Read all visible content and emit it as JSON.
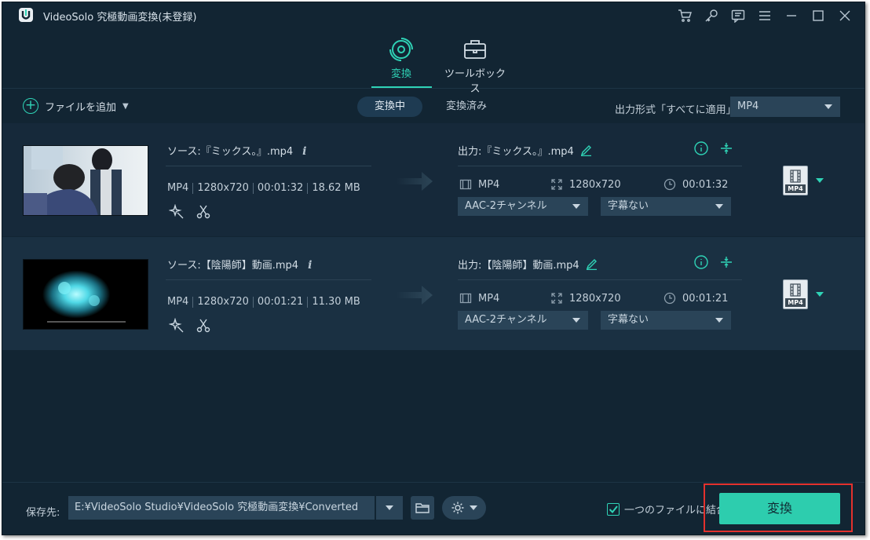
{
  "window": {
    "title": "VideoSolo 究極動画変換(未登録)"
  },
  "tabs": [
    {
      "label": "変換",
      "icon": "convert-disc-icon",
      "active": true
    },
    {
      "label": "ツールボックス",
      "icon": "toolbox-icon",
      "active": false
    }
  ],
  "toolbar": {
    "add_file_label": "ファイルを追加",
    "segments": [
      "変換中",
      "変換済み"
    ],
    "output_format_label": "出力形式「すべてに適用」:",
    "output_format_value": "MP4"
  },
  "files": [
    {
      "source_name": "ソース:『ミックス。』.mp4",
      "format": "MP4",
      "resolution": "1280x720",
      "duration": "00:01:32",
      "size": "18.62 MB",
      "output_name": "出力:『ミックス。』.mp4",
      "out_format": "MP4",
      "out_resolution": "1280x720",
      "out_duration": "00:01:32",
      "audio": "AAC-2チャンネル",
      "subtitle": "字幕ない",
      "format_badge": "MP4"
    },
    {
      "source_name": "ソース:【陰陽師】動画.mp4",
      "format": "MP4",
      "resolution": "1280x720",
      "duration": "00:01:21",
      "size": "11.30 MB",
      "output_name": "出力:【陰陽師】動画.mp4",
      "out_format": "MP4",
      "out_resolution": "1280x720",
      "out_duration": "00:01:21",
      "audio": "AAC-2チャンネル",
      "subtitle": "字幕ない",
      "format_badge": "MP4"
    }
  ],
  "footer": {
    "save_label": "保存先:",
    "save_path": "E:¥VideoSolo Studio¥VideoSolo 究極動画変換¥Converted",
    "merge_label": "一つのファイルに結合",
    "merge_checked": true,
    "convert_label": "変換"
  },
  "colors": {
    "accent": "#2fd3b6",
    "background": "#122533",
    "highlight_border": "#e3312d"
  }
}
